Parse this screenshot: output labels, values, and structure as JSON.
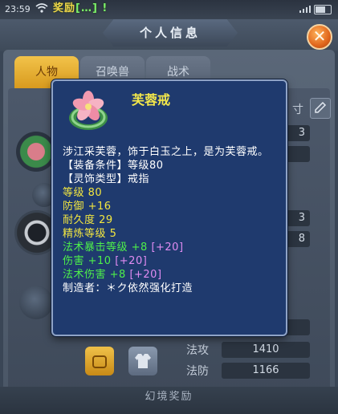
{
  "statusbar": {
    "time": "23:59",
    "banner_label": "奖励",
    "banner_text": "[…] !"
  },
  "title": "个人信息",
  "tabs": [
    {
      "label": "人物"
    },
    {
      "label": "召唤兽"
    },
    {
      "label": "战术"
    }
  ],
  "side_label": "寸",
  "fields": [
    "3",
    "",
    "3",
    "8",
    "",
    "",
    "",
    "",
    "",
    "1410",
    "1166"
  ],
  "stats": [
    {
      "label": "法攻",
      "value": "1410"
    },
    {
      "label": "法防",
      "value": "1166"
    }
  ],
  "footer": "幻境奖励",
  "tooltip": {
    "name": "芙蓉戒",
    "description": "涉江采芙蓉，饰于白玉之上，是为芙蓉戒。",
    "requirement": "【装备条件】等级80",
    "type": "【灵饰类型】戒指",
    "level": "等级 80",
    "defense": "防御 +16",
    "durability": "耐久度 29",
    "refine": "精炼等级 5",
    "bonus1": {
      "text": "法术暴击等级 +8",
      "extra": "[+20]"
    },
    "bonus2": {
      "text": "伤害 +10",
      "extra": "[+20]"
    },
    "bonus3": {
      "text": "法术伤害 +8",
      "extra": "[+20]"
    },
    "maker": "制造者：＊ク依然强化打造"
  }
}
